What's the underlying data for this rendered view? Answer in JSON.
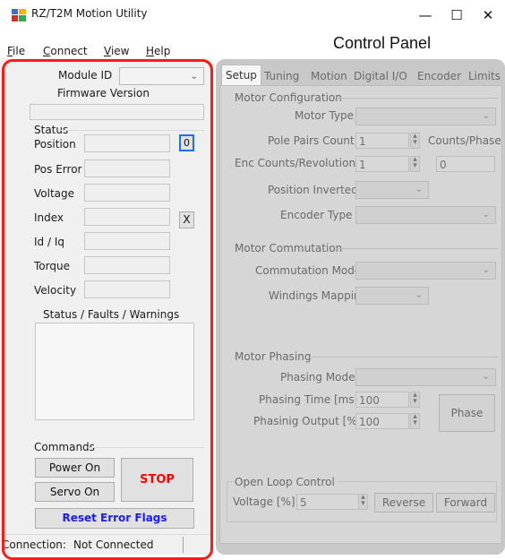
{
  "window": {
    "title": "RZ/T2M Motion Utility",
    "minimize_glyph": "—",
    "maximize_glyph": "☐",
    "close_glyph": "✕"
  },
  "menu": {
    "file": {
      "key": "F",
      "rest": "ile"
    },
    "connect": {
      "key": "C",
      "rest": "onnect"
    },
    "view": {
      "key": "V",
      "rest": "iew"
    },
    "help": {
      "key": "H",
      "rest": "elp"
    }
  },
  "control_panel_caption": "Control Panel",
  "left": {
    "module_id_label": "Module ID",
    "module_id_value": "",
    "firmware_version_label": "Firmware Version",
    "firmware_version_value": "",
    "status_group": "Status",
    "position_label": "Position",
    "zero_button": "0",
    "pos_error_label": "Pos Error",
    "voltage_label": "Voltage",
    "index_label": "Index",
    "index_clear_button": "X",
    "id_iq_label": "Id / Iq",
    "torque_label": "Torque",
    "velocity_label": "Velocity",
    "faults_label": "Status / Faults / Warnings",
    "commands_group": "Commands",
    "power_on": "Power On",
    "servo_on": "Servo On",
    "stop": "STOP",
    "reset_error_flags": "Reset Error Flags",
    "stop_color": "#ff0000",
    "reset_color": "#1a1aff"
  },
  "status_bar": {
    "connection_label": "Connection:",
    "connection_value": "Not Connected"
  },
  "tabs": [
    "Setup",
    "Tuning",
    "Motion",
    "Digital I/O",
    "Encoder",
    "Limits"
  ],
  "setup": {
    "motor_configuration": "Motor Configuration",
    "motor_type_label": "Motor Type",
    "pole_pairs_label": "Pole Pairs Count",
    "pole_pairs_value": "1",
    "counts_phase_label": "Counts/Phase",
    "enc_counts_label": "Enc Counts/Revolution",
    "enc_counts_value": "1",
    "counts_phase_value": "0",
    "position_inverted_label": "Position Inverted",
    "encoder_type_label": "Encoder Type",
    "motor_commutation": "Motor Commutation",
    "commutation_mode_label": "Commutation Mode",
    "windings_mapping_label": "Windings Mapping",
    "motor_phasing": "Motor Phasing",
    "phasing_mode_label": "Phasing Mode",
    "phasing_time_label": "Phasing Time [ms]",
    "phasing_time_value": "100",
    "phasing_output_label": "Phasinig Output [%]",
    "phasing_output_value": "100",
    "phase_button": "Phase",
    "open_loop_control": "Open Loop Control",
    "voltage_label": "Voltage [%]",
    "voltage_value": "5",
    "reverse_button": "Reverse",
    "forward_button": "Forward"
  },
  "colors": {
    "highlight_outline": "#ff1a1a",
    "disabled_panel": "#d6d6d6"
  }
}
